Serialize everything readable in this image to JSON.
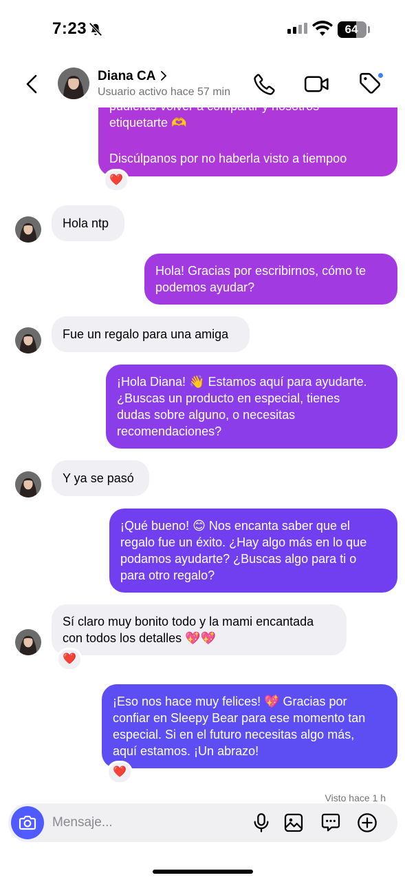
{
  "status_bar": {
    "time": "7:23",
    "battery": "64",
    "battery_level": 0.64
  },
  "header": {
    "name": "Diana CA",
    "status": "Usuario activo hace 57 min"
  },
  "messages": [
    {
      "direction": "out",
      "lines": [
        "pudieras volver a compartir y nosotros",
        "etiquetarte 🫶",
        "",
        "Discúlpanos por no haberla visto a tiempoo"
      ],
      "reaction": "❤️"
    },
    {
      "direction": "in",
      "lines": [
        "Hola ntp"
      ]
    },
    {
      "direction": "out",
      "lines": [
        "Hola! Gracias por escribirnos, cómo te",
        "podemos ayudar?"
      ]
    },
    {
      "direction": "in",
      "lines": [
        "Fue un regalo para una amiga"
      ]
    },
    {
      "direction": "out",
      "lines": [
        "¡Hola Diana! 👋 Estamos aquí para ayudarte.",
        "¿Buscas un producto en especial, tienes",
        "dudas sobre alguno, o necesitas",
        "recomendaciones?"
      ]
    },
    {
      "direction": "in",
      "lines": [
        "Y ya se pasó"
      ]
    },
    {
      "direction": "out",
      "lines": [
        "¡Qué bueno! 😊 Nos encanta saber que el",
        "regalo fue un éxito. ¿Hay algo más en lo que",
        "podamos ayudarte? ¿Buscas algo para ti o",
        "para otro regalo?"
      ]
    },
    {
      "direction": "in",
      "lines": [
        "Sí claro muy bonito todo y la mami encantada",
        "con todos los detalles 💖💖"
      ],
      "reaction": "❤️"
    },
    {
      "direction": "out",
      "lines": [
        "¡Eso nos hace muy felices! 💖 Gracias por",
        "confiar en Sleepy Bear para ese momento tan",
        "especial. Si en el futuro necesitas algo más,",
        "aquí estamos. ¡Un abrazo!"
      ],
      "reaction": "❤️"
    }
  ],
  "seen_text": "Visto hace 1 h",
  "composer": {
    "placeholder": "Mensaje..."
  },
  "colors": {
    "accent": "#4f5bff",
    "outgoing_top": "#b237d8",
    "outgoing_bottom": "#5552f5",
    "incoming": "#efeff4"
  },
  "icons": [
    "back-icon",
    "chevron-right-icon",
    "phone-icon",
    "video-camera-icon",
    "tag-icon",
    "camera-icon",
    "microphone-icon",
    "gallery-icon",
    "sticker-chat-icon",
    "plus-icon"
  ]
}
